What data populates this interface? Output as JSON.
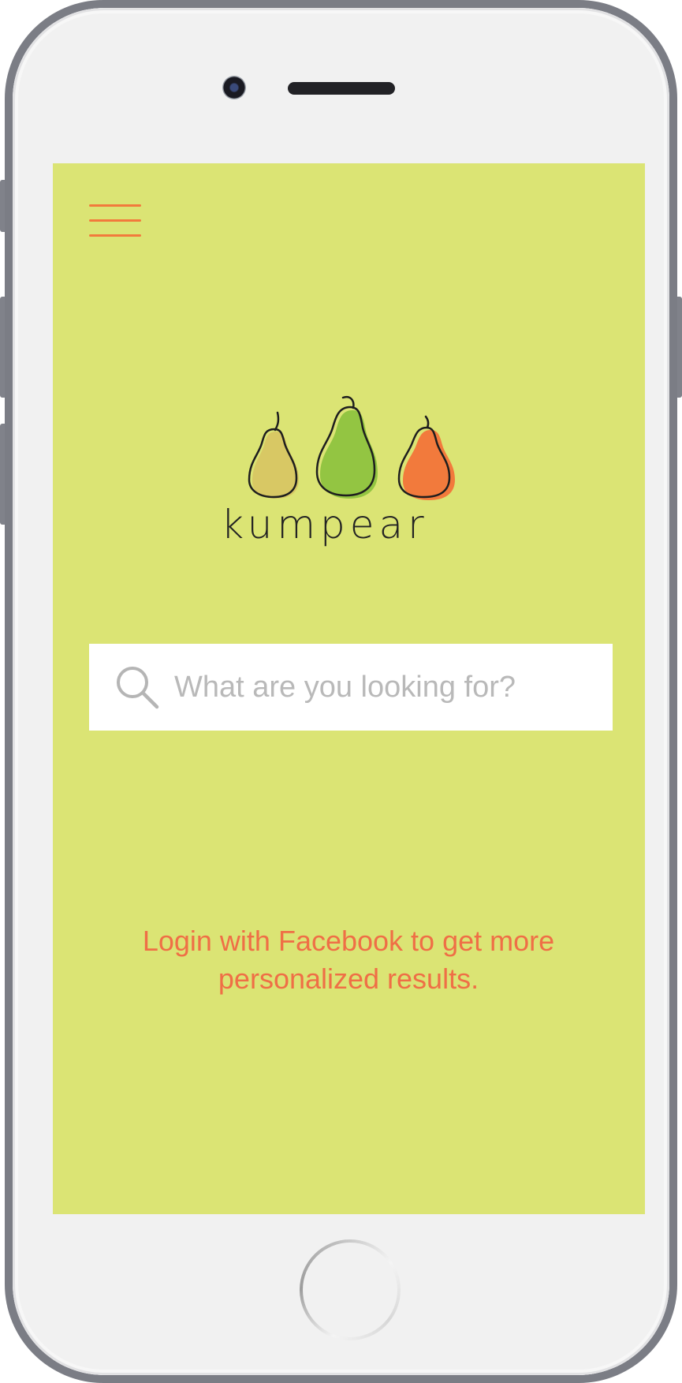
{
  "app": {
    "name": "kumpear"
  },
  "colors": {
    "screen_background": "#dbe474",
    "accent_orange": "#f27a3c",
    "login_text": "#ef6f46",
    "pear_yellow": "#d8c864",
    "pear_green": "#93c542",
    "pear_orange": "#f27a3c"
  },
  "header": {
    "menu_icon": "hamburger-menu-icon"
  },
  "search": {
    "icon": "search-icon",
    "placeholder": "What are you looking for?",
    "value": ""
  },
  "login_prompt": {
    "line1": "Login with Facebook to get more",
    "line2": "personalized results."
  }
}
